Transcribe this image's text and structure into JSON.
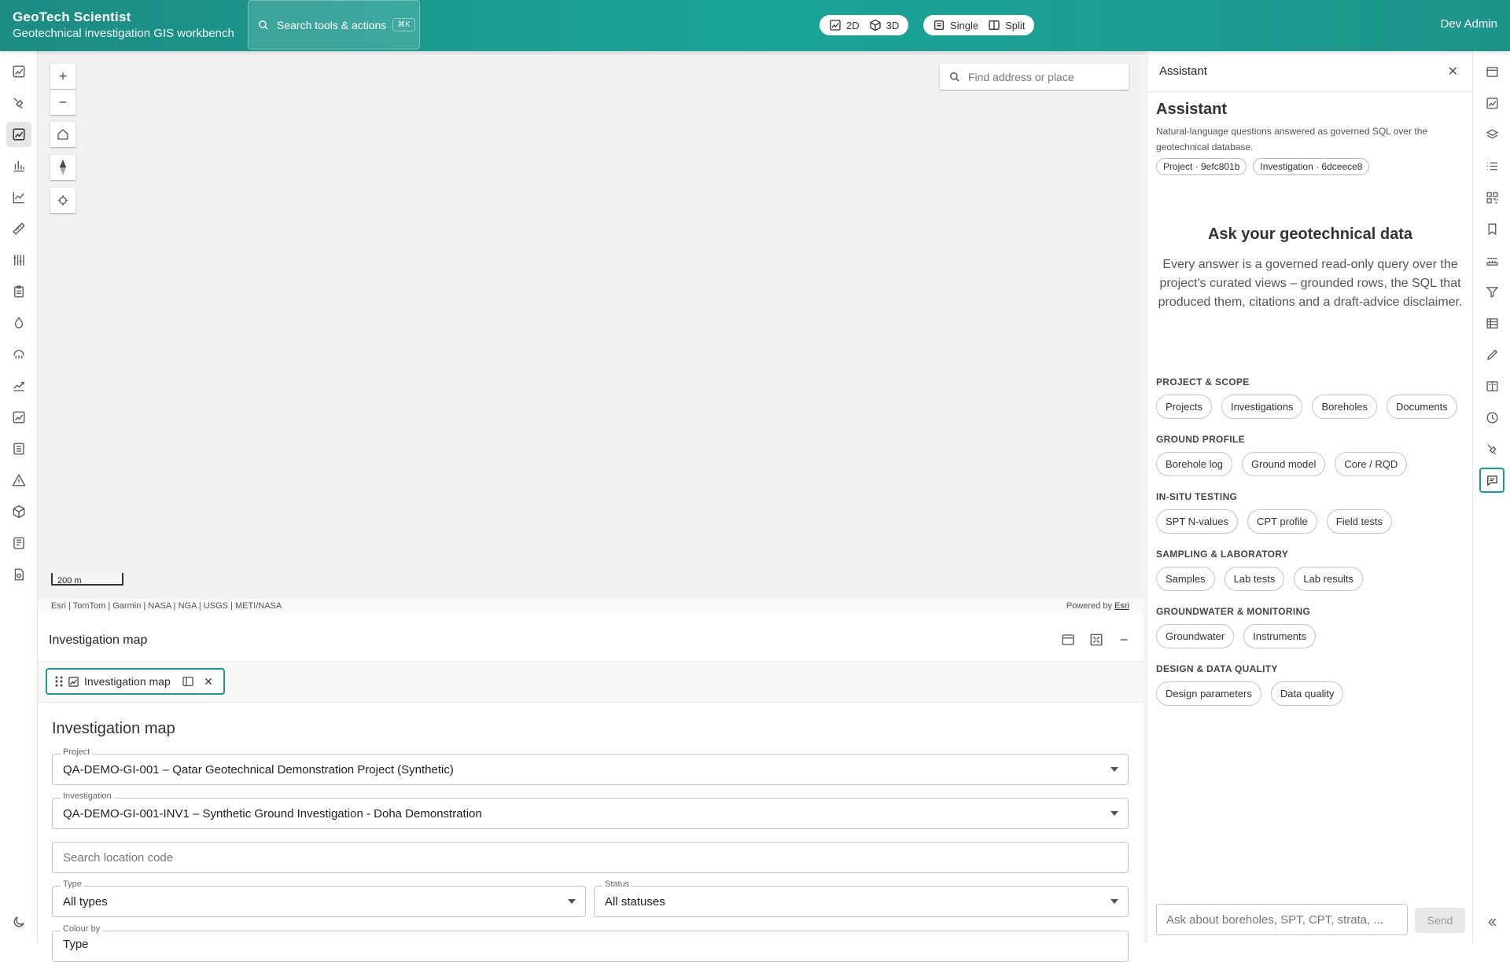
{
  "app": {
    "title": "GeoTech Scientist",
    "subtitle": "Geotechnical investigation GIS workbench",
    "user": "Dev Admin"
  },
  "topbar": {
    "search_label": "Search tools & actions",
    "search_shortcut": "⌘K",
    "view_modes": [
      "2D",
      "3D"
    ],
    "layout_modes": [
      "Single",
      "Split"
    ]
  },
  "left_toolbar": {
    "icons": [
      "map-icon",
      "drill-icon",
      "map-active-icon",
      "bar-chart-icon",
      "line-chart-icon",
      "ruler-icon",
      "borehole-icon",
      "clipboard-icon",
      "water-drop-icon",
      "sample-icon",
      "trend-icon",
      "map2-icon",
      "report-icon",
      "warning-icon",
      "cube-icon",
      "document-icon",
      "file-icon",
      "moon-icon"
    ]
  },
  "map": {
    "search_placeholder": "Find address or place",
    "scale_label": "200 m",
    "attribution": "Esri | TomTom | Garmin | NASA | NGA | USGS | METI/NASA",
    "powered_by": "Powered by",
    "powered_by_link": "Esri",
    "controls": {
      "zoom_in": "+",
      "zoom_out": "−"
    }
  },
  "panel": {
    "header_title": "Investigation map",
    "tab_label": "Investigation map",
    "content_title": "Investigation map",
    "project": {
      "label": "Project",
      "value": "QA-DEMO-GI-001 – Qatar Geotechnical Demonstration Project (Synthetic)"
    },
    "investigation": {
      "label": "Investigation",
      "value": "QA-DEMO-GI-001-INV1 – Synthetic Ground Investigation - Doha Demonstration"
    },
    "location_placeholder": "Search location code",
    "type_filter": {
      "label": "Type",
      "value": "All types"
    },
    "status_filter": {
      "label": "Status",
      "value": "All statuses"
    },
    "colour_by": {
      "label": "Colour by",
      "value": "Type"
    }
  },
  "assistant": {
    "panel_title": "Assistant",
    "heading": "Assistant",
    "description": "Natural-language questions answered as governed SQL over the geotechnical database.",
    "context_chips": [
      "Project · 9efc801b",
      "Investigation · 6dceece8"
    ],
    "ask_heading": "Ask your geotechnical data",
    "ask_text": "Every answer is a governed read-only query over the project's curated views – grounded rows, the SQL that produced them, citations and a draft-advice disclaimer.",
    "sections": [
      {
        "title": "PROJECT & SCOPE",
        "items": [
          "Projects",
          "Investigations",
          "Boreholes",
          "Documents"
        ]
      },
      {
        "title": "GROUND PROFILE",
        "items": [
          "Borehole log",
          "Ground model",
          "Core / RQD"
        ]
      },
      {
        "title": "IN-SITU TESTING",
        "items": [
          "SPT N-values",
          "CPT profile",
          "Field tests"
        ]
      },
      {
        "title": "SAMPLING & LABORATORY",
        "items": [
          "Samples",
          "Lab tests",
          "Lab results"
        ]
      },
      {
        "title": "GROUNDWATER & MONITORING",
        "items": [
          "Groundwater",
          "Instruments"
        ]
      },
      {
        "title": "DESIGN & DATA QUALITY",
        "items": [
          "Design parameters",
          "Data quality"
        ]
      }
    ],
    "input_placeholder": "Ask about boreholes, SPT, CPT, strata, ...",
    "send_label": "Send"
  },
  "right_toolbar": {
    "icons": [
      "window-icon",
      "map-icon",
      "layers-icon",
      "list-icon",
      "qr-icon",
      "bookmark-icon",
      "measure-icon",
      "filter-icon",
      "table-icon",
      "pencil-icon",
      "compare-icon",
      "clock-icon",
      "drill-icon",
      "chat-icon",
      "collapse-icon"
    ]
  },
  "colors": {
    "accent": "#1a9c8e",
    "topbar": "#1aa598",
    "map_bg": "#f1f1ef"
  }
}
